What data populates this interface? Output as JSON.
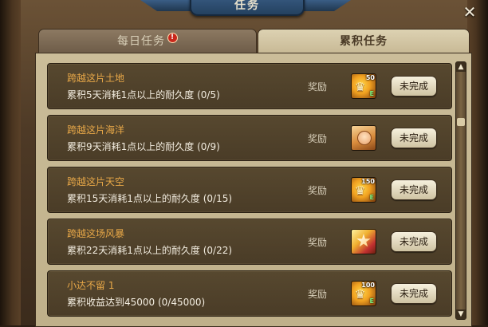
{
  "window": {
    "title": "任务",
    "close_icon": "✕"
  },
  "tabs": [
    {
      "label": "每日任务",
      "alert": "!"
    },
    {
      "label": "累积任务"
    }
  ],
  "reward_label": "奖励",
  "tasks": [
    {
      "title": "跨越这片土地",
      "desc": "累积5天消耗1点以上的耐久度 (0/5)",
      "reward_icon": "coin-reward-icon",
      "reward_amount": "50",
      "status": "未完成"
    },
    {
      "title": "跨越这片海洋",
      "desc": "累积9天消耗1点以上的耐久度 (0/9)",
      "reward_icon": "character-card-icon",
      "status": "未完成"
    },
    {
      "title": "跨越这片天空",
      "desc": "累积15天消耗1点以上的耐久度 (0/15)",
      "reward_icon": "coin-reward-icon",
      "reward_amount": "150",
      "status": "未完成"
    },
    {
      "title": "跨越这场风暴",
      "desc": "累积22天消耗1点以上的耐久度 (0/22)",
      "reward_icon": "star-card-icon",
      "status": "未完成"
    },
    {
      "title": "小达不留 1",
      "desc": "累积收益达到45000 (0/45000)",
      "reward_icon": "coin-reward-icon",
      "reward_amount": "100",
      "status": "未完成"
    }
  ],
  "scroll": {
    "up_icon": "▲",
    "down_icon": "▼"
  }
}
